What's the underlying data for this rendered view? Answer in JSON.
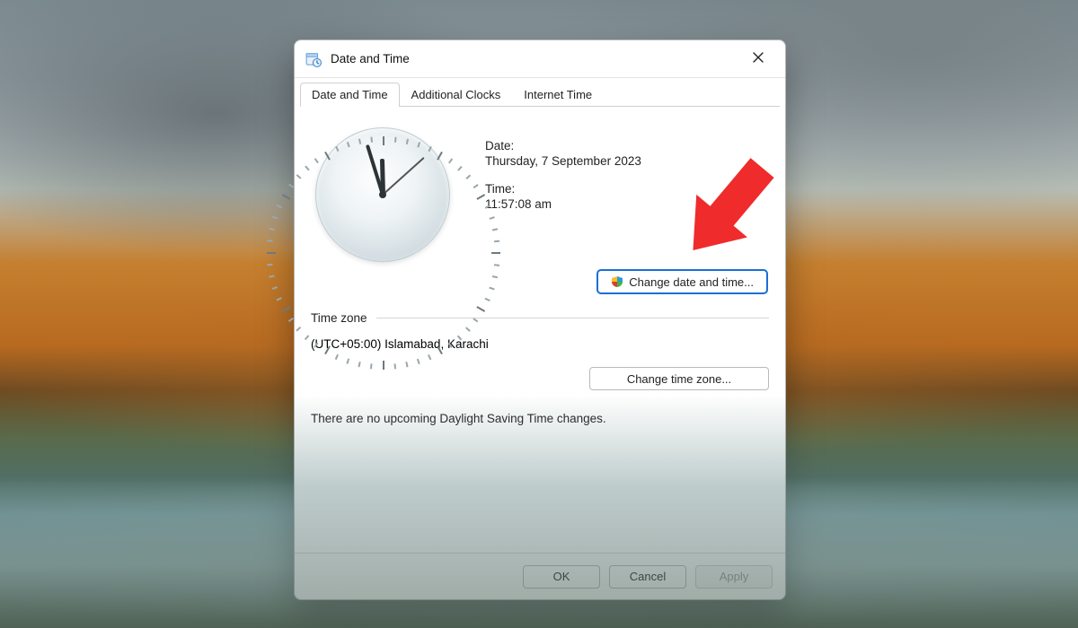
{
  "window": {
    "title": "Date and Time"
  },
  "tabs": [
    {
      "label": "Date and Time"
    },
    {
      "label": "Additional Clocks"
    },
    {
      "label": "Internet Time"
    }
  ],
  "datetime": {
    "date_label": "Date:",
    "date_value": "Thursday, 7 September 2023",
    "time_label": "Time:",
    "time_value": "11:57:08 am",
    "change_button": "Change date and time...",
    "clock": {
      "hour": 11,
      "minute": 57,
      "second": 8
    }
  },
  "timezone": {
    "section_label": "Time zone",
    "value": "(UTC+05:00) Islamabad, Karachi",
    "change_button": "Change time zone..."
  },
  "dst_note": "There are no upcoming Daylight Saving Time changes.",
  "footer": {
    "ok": "OK",
    "cancel": "Cancel",
    "apply": "Apply"
  }
}
